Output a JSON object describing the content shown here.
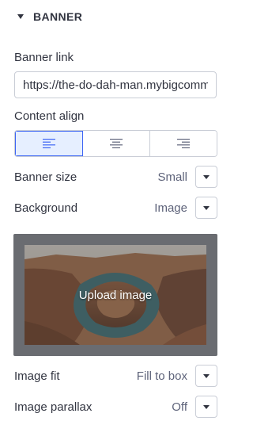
{
  "section": {
    "title": "BANNER"
  },
  "banner_link": {
    "label": "Banner link",
    "value": "https://the-do-dah-man.mybigcommerce.com"
  },
  "content_align": {
    "label": "Content align",
    "options": [
      "left",
      "center",
      "right"
    ],
    "selected": "left"
  },
  "banner_size": {
    "label": "Banner size",
    "value": "Small"
  },
  "background": {
    "label": "Background",
    "value": "Image"
  },
  "image_upload": {
    "label": "Upload image",
    "thumbnail": "canyon-river-bend-photo"
  },
  "image_fit": {
    "label": "Image fit",
    "value": "Fill to box"
  },
  "image_parallax": {
    "label": "Image parallax",
    "value": "Off"
  },
  "colors": {
    "accent": "#3c64f4",
    "active_bg": "#e6efff",
    "border": "#c9cdd6",
    "text": "#313440",
    "muted": "#5e637a"
  }
}
